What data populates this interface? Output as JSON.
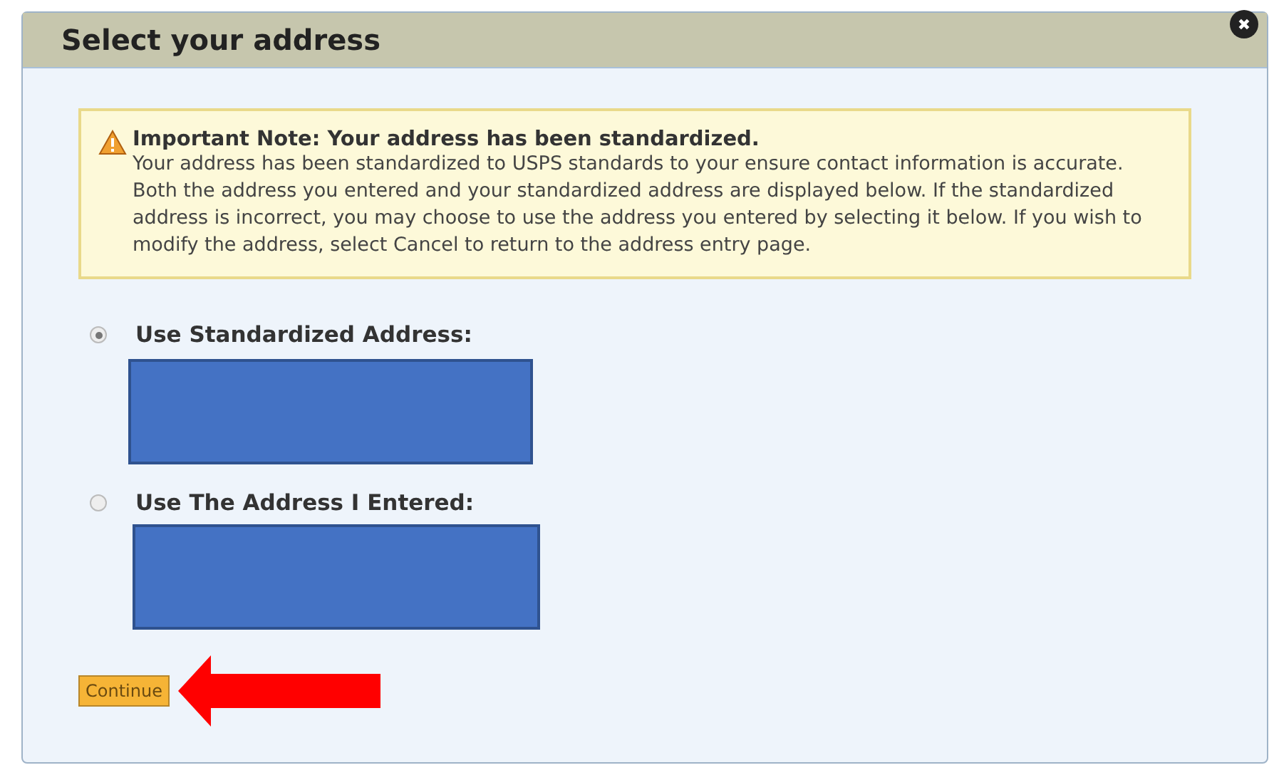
{
  "dialog": {
    "title": "Select your address",
    "close_icon": "✖"
  },
  "note": {
    "title": "Important Note: Your address has been standardized.",
    "text": "Your address has been standardized to USPS standards to your ensure contact information is accurate. Both the address you entered and your standardized address are displayed below. If the standardized address is incorrect, you may choose to use the address you entered by selecting it below. If you wish to modify the address, select Cancel to return to the address entry page."
  },
  "options": [
    {
      "label": "Use Standardized Address:",
      "selected": true
    },
    {
      "label": "Use The Address I Entered:",
      "selected": false
    }
  ],
  "buttons": [
    {
      "label": "Continue"
    }
  ]
}
